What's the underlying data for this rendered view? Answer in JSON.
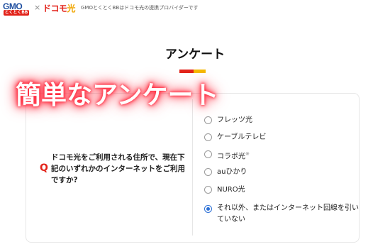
{
  "header": {
    "gmo_logo_text": "GMO",
    "gmo_logo_sub": "とくとくBB",
    "times": "×",
    "docomo_logo_main": "ドコモ",
    "docomo_logo_hikari": "光",
    "description": "GMOとくとくBBはドコモ光の提携プロバイダーです"
  },
  "page": {
    "title": "アンケート",
    "overlay_caption": "簡単なアンケート"
  },
  "question": {
    "mark": "Q",
    "text": "ドコモ光をご利用される住所で、現在下記のいずれかのインターネットをご利用ですか?"
  },
  "options": [
    {
      "label": "フレッツ光",
      "checked": false
    },
    {
      "label": "ケーブルテレビ",
      "checked": false
    },
    {
      "label": "コラボ光",
      "note": "※",
      "checked": false
    },
    {
      "label": "auひかり",
      "checked": false
    },
    {
      "label": "NURO光",
      "checked": false
    },
    {
      "label": "それ以外、またはインターネット回線を引いていない",
      "checked": true
    }
  ],
  "colors": {
    "brand_red": "#e2231a",
    "brand_yellow": "#f5b800",
    "radio_selected": "#2b6fd6",
    "overlay_glow": "#ff2a3d"
  }
}
